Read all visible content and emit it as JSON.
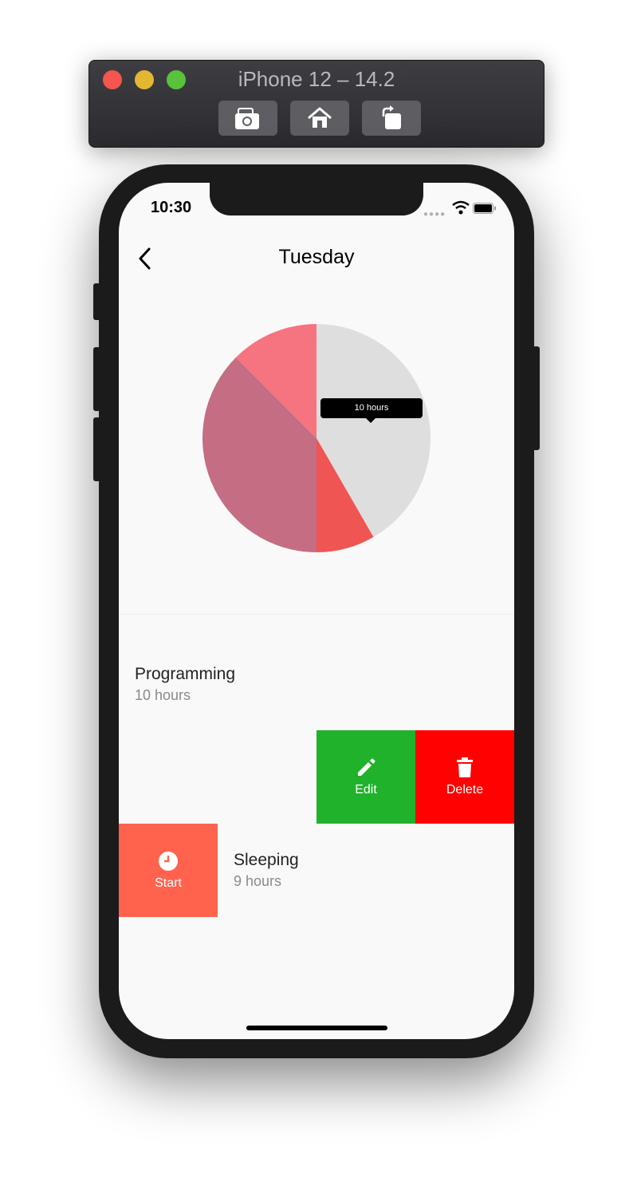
{
  "window": {
    "title": "iPhone 12 – 14.2"
  },
  "toolbar": [
    {
      "icon": "camera-icon"
    },
    {
      "icon": "home-icon"
    },
    {
      "icon": "rotate-icon"
    }
  ],
  "status_bar": {
    "time": "10:30"
  },
  "header": {
    "title": "Tuesday",
    "back_icon": "chevron-left-icon"
  },
  "chart_data": {
    "type": "pie",
    "slices": [
      {
        "value": 10,
        "color": "#dedede"
      },
      {
        "value": 2,
        "color": "#ef5552"
      },
      {
        "value": 9,
        "color": "#c46d83"
      },
      {
        "value": 3,
        "color": "#f67480"
      }
    ],
    "tooltip": "10 hours"
  },
  "activities": [
    {
      "title": "Programming",
      "subtitle": "10 hours"
    },
    {
      "title": "Sleeping",
      "subtitle": "9 hours"
    }
  ],
  "actions": {
    "edit": {
      "label": "Edit",
      "icon": "pencil-icon",
      "color": "#20b22b"
    },
    "delete": {
      "label": "Delete",
      "icon": "trash-icon",
      "color": "#fe0100"
    },
    "start": {
      "label": "Start",
      "icon": "clock-icon",
      "color": "#ff634d"
    }
  }
}
